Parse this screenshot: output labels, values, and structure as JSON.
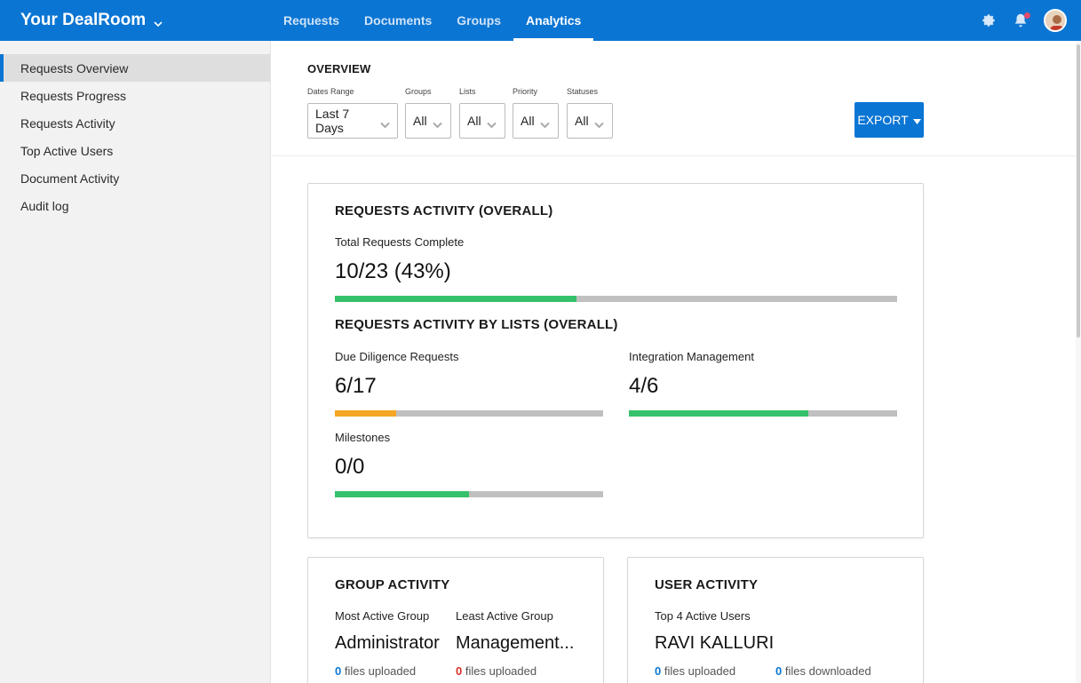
{
  "brand": {
    "name": "Your DealRoom"
  },
  "nav": {
    "items": [
      {
        "label": "Requests"
      },
      {
        "label": "Documents"
      },
      {
        "label": "Groups"
      },
      {
        "label": "Analytics"
      }
    ],
    "active_index": 3
  },
  "icons": {
    "settings": "gear-icon",
    "notifications": "bell-icon",
    "avatar": "user-avatar"
  },
  "sidebar": {
    "items": [
      {
        "label": "Requests Overview"
      },
      {
        "label": "Requests Progress"
      },
      {
        "label": "Requests Activity"
      },
      {
        "label": "Top Active Users"
      },
      {
        "label": "Document Activity"
      },
      {
        "label": "Audit log"
      }
    ],
    "active_index": 0
  },
  "overview": {
    "title": "OVERVIEW",
    "filters": [
      {
        "label": "Dates Range",
        "value": "Last 7 Days"
      },
      {
        "label": "Groups",
        "value": "All"
      },
      {
        "label": "Lists",
        "value": "All"
      },
      {
        "label": "Priority",
        "value": "All"
      },
      {
        "label": "Statuses",
        "value": "All"
      }
    ],
    "export_label": "EXPORT"
  },
  "requests_activity": {
    "title": "REQUESTS ACTIVITY (OVERALL)",
    "total_label": "Total Requests Complete",
    "total_value": "10/23 (43%)",
    "total_progress": 0.43,
    "by_lists_title": "REQUESTS ACTIVITY BY LISTS (OVERALL)",
    "lists": [
      {
        "name": "Due Diligence Requests",
        "value": "6/17",
        "progress": 0.23,
        "color": "#f5a623"
      },
      {
        "name": "Integration Management",
        "value": "4/6",
        "progress": 0.67,
        "color": "#35c16b"
      },
      {
        "name": "Milestones",
        "value": "0/0",
        "progress": 0.5,
        "color": "#35c16b"
      }
    ]
  },
  "group_activity": {
    "title": "GROUP ACTIVITY",
    "most_label": "Most Active Group",
    "least_label": "Least Active Group",
    "most_value": "Administrator",
    "least_value": "Management...",
    "most_files_num": "0",
    "least_files_num": "0",
    "files_uploaded_label": "files uploaded"
  },
  "user_activity": {
    "title": "USER ACTIVITY",
    "top_label": "Top 4 Active Users",
    "user_name": "RAVI KALLURI",
    "uploaded_num": "0",
    "uploaded_label": "files uploaded",
    "downloaded_num": "0",
    "downloaded_label": "files downloaded"
  },
  "colors": {
    "brand": "#0b75d3",
    "progress_green": "#35c16b",
    "progress_orange": "#f5a623",
    "track": "#c0c0c0",
    "stat_blue": "#0b75d3",
    "stat_red": "#d93025"
  }
}
